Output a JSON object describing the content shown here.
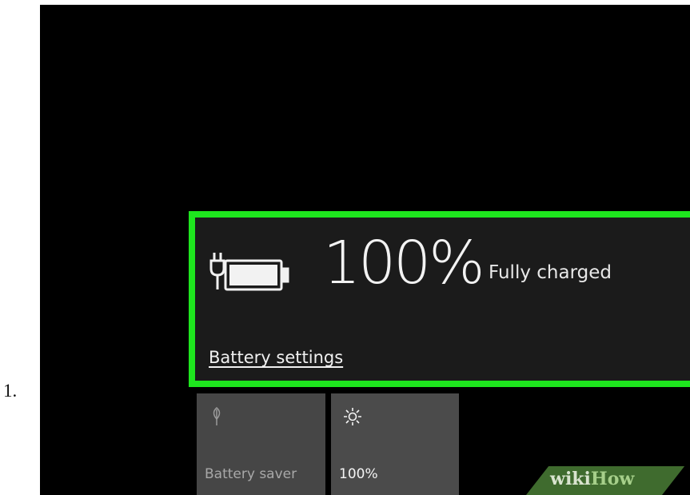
{
  "step_number": "1.",
  "battery": {
    "icon": "plugged-in-battery-icon",
    "level_percent": 100,
    "percent_text": "100%",
    "status_text": "Fully charged",
    "settings_link": "Battery settings"
  },
  "quick_actions": [
    {
      "label": "Battery saver",
      "icon": "leaf-icon"
    },
    {
      "label": "100%",
      "icon": "brightness-icon"
    }
  ],
  "watermark": {
    "part1": "wiki",
    "part2": "How"
  },
  "colors": {
    "highlight": "#1ee51e",
    "panel": "#1b1b1b",
    "tile": "#4a4a4a",
    "screen": "#000000"
  }
}
